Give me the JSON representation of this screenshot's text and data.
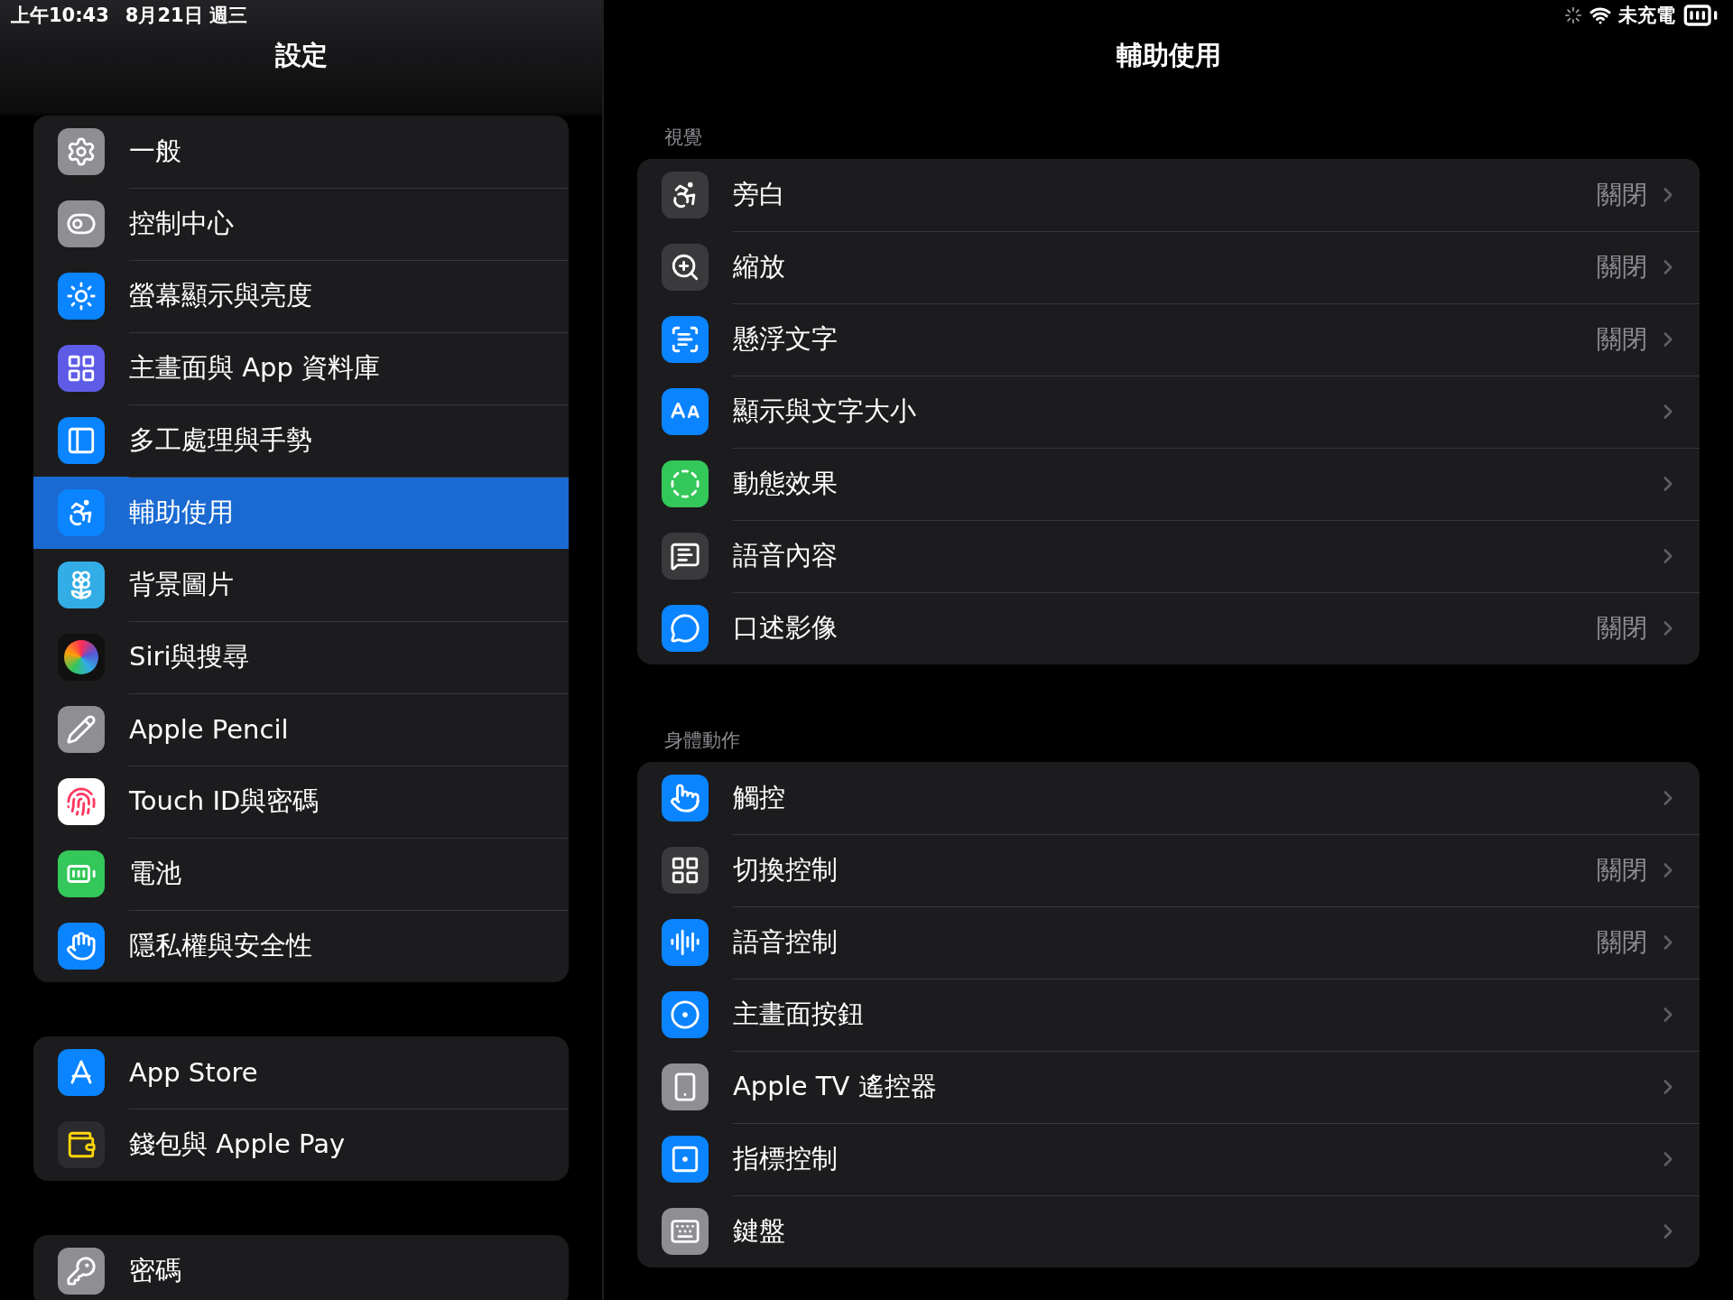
{
  "status_bar": {
    "time": "上午10:43",
    "date": "8月21日 週三",
    "charging": "未充電"
  },
  "sidebar": {
    "title": "設定",
    "groups": [
      {
        "items": [
          {
            "label": "一般",
            "selected": false
          },
          {
            "label": "控制中心",
            "selected": false
          },
          {
            "label": "螢幕顯示與亮度",
            "selected": false
          },
          {
            "label": "主畫面與 App 資料庫",
            "selected": false
          },
          {
            "label": "多工處理與手勢",
            "selected": false
          },
          {
            "label": "輔助使用",
            "selected": true
          },
          {
            "label": "背景圖片",
            "selected": false
          },
          {
            "label": "Siri與搜尋",
            "selected": false
          },
          {
            "label": "Apple Pencil",
            "selected": false
          },
          {
            "label": "Touch ID與密碼",
            "selected": false
          },
          {
            "label": "電池",
            "selected": false
          },
          {
            "label": "隱私權與安全性",
            "selected": false
          }
        ]
      },
      {
        "items": [
          {
            "label": "App Store",
            "selected": false
          },
          {
            "label": "錢包與 Apple Pay",
            "selected": false
          }
        ]
      },
      {
        "items": [
          {
            "label": "密碼",
            "selected": false
          }
        ]
      }
    ]
  },
  "detail": {
    "title": "輔助使用",
    "sections": [
      {
        "header": "視覺",
        "rows": [
          {
            "label": "旁白",
            "value": "關閉"
          },
          {
            "label": "縮放",
            "value": "關閉"
          },
          {
            "label": "懸浮文字",
            "value": "關閉"
          },
          {
            "label": "顯示與文字大小"
          },
          {
            "label": "動態效果"
          },
          {
            "label": "語音內容"
          },
          {
            "label": "口述影像",
            "value": "關閉"
          }
        ]
      },
      {
        "header": "身體動作",
        "rows": [
          {
            "label": "觸控"
          },
          {
            "label": "切換控制",
            "value": "關閉"
          },
          {
            "label": "語音控制",
            "value": "關閉"
          },
          {
            "label": "主畫面按鈕"
          },
          {
            "label": "Apple TV 遙控器"
          },
          {
            "label": "指標控制"
          },
          {
            "label": "鍵盤"
          }
        ]
      }
    ]
  }
}
